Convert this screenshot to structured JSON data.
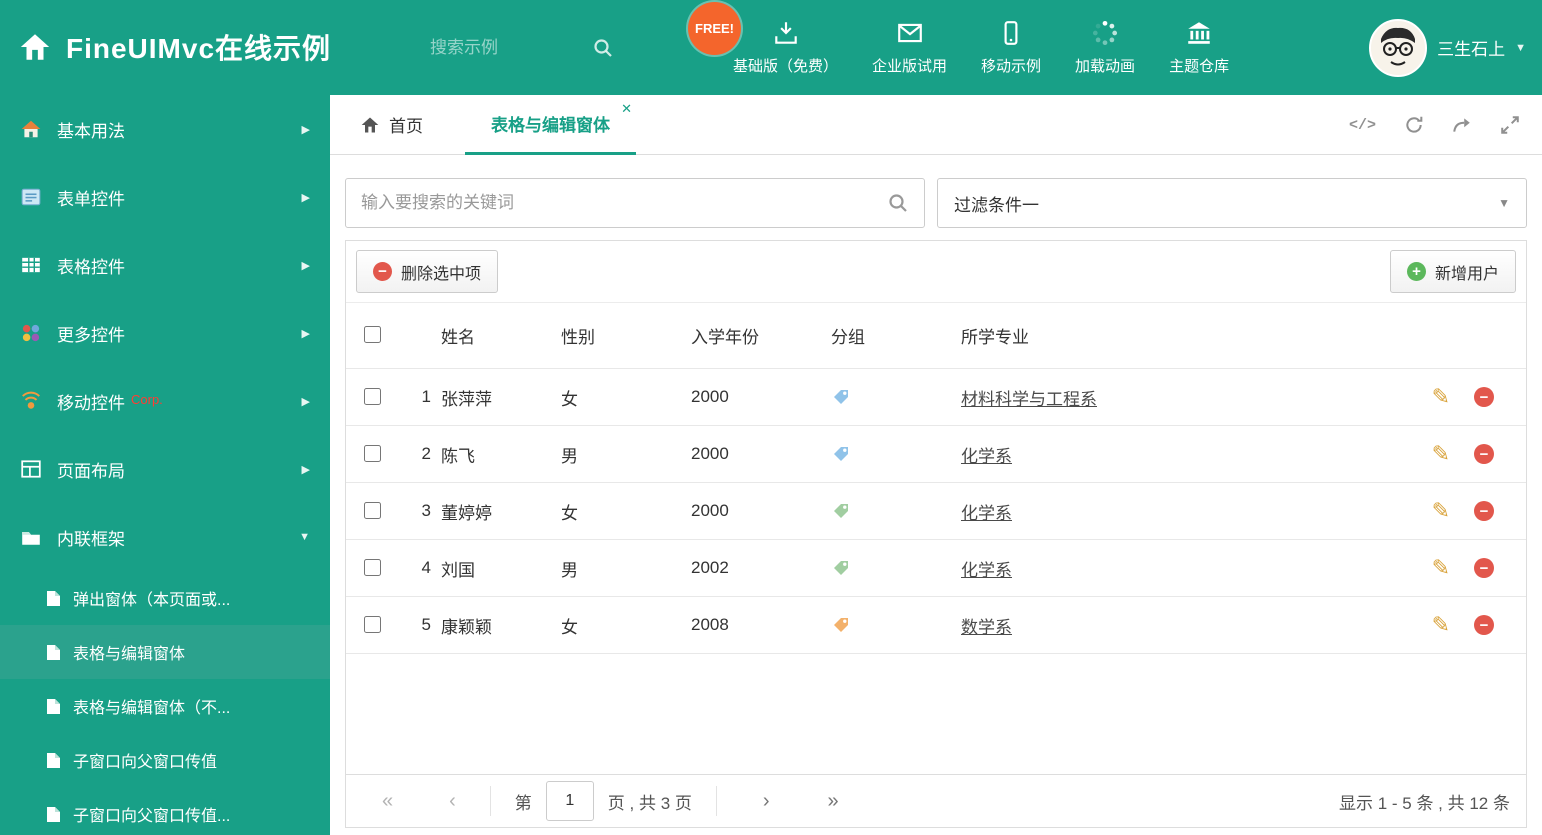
{
  "colors": {
    "theme": "#18A087",
    "sidebar_active": "#2BA28D",
    "free_badge": "#F4652C",
    "danger": "#E2574C",
    "success": "#5CB85C",
    "pencil": "#D9A33B"
  },
  "icons": {
    "chevron_right": "▶",
    "chevron_down": "▼",
    "caret_down": "▼",
    "close": "✕",
    "code": "</>",
    "pencil": "✎",
    "minus": "−",
    "plus": "+",
    "first": "«",
    "prev": "‹",
    "next": "›",
    "last": "»"
  },
  "header": {
    "title": "FineUIMvc在线示例",
    "search_placeholder": "搜索示例",
    "free_badge": "FREE!",
    "nav": [
      {
        "label": "基础版（免费）"
      },
      {
        "label": "企业版试用"
      },
      {
        "label": "移动示例"
      },
      {
        "label": "加载动画"
      },
      {
        "label": "主题仓库"
      }
    ],
    "user_name": "三生石上"
  },
  "sidebar": {
    "items": [
      {
        "label": "基本用法"
      },
      {
        "label": "表单控件"
      },
      {
        "label": "表格控件"
      },
      {
        "label": "更多控件"
      },
      {
        "label": "移动控件",
        "badge": "Corp."
      },
      {
        "label": "页面布局"
      },
      {
        "label": "内联框架"
      }
    ],
    "subitems": [
      {
        "label": "弹出窗体（本页面或..."
      },
      {
        "label": "表格与编辑窗体"
      },
      {
        "label": "表格与编辑窗体（不..."
      },
      {
        "label": "子窗口向父窗口传值"
      },
      {
        "label": "子窗口向父窗口传值..."
      }
    ]
  },
  "tabs": {
    "home_label": "首页",
    "active_label": "表格与编辑窗体"
  },
  "filter": {
    "search_placeholder": "输入要搜索的关键词",
    "dropdown_value": "过滤条件一"
  },
  "toolbar": {
    "delete_label": "删除选中项",
    "add_label": "新增用户"
  },
  "table": {
    "columns": [
      "姓名",
      "性别",
      "入学年份",
      "分组",
      "所学专业"
    ],
    "rows": [
      {
        "num": "1",
        "name": "张萍萍",
        "gender": "女",
        "year": "2000",
        "tag_color": "#7CB9E5",
        "major": "材料科学与工程系"
      },
      {
        "num": "2",
        "name": "陈飞",
        "gender": "男",
        "year": "2000",
        "tag_color": "#7CB9E5",
        "major": "化学系"
      },
      {
        "num": "3",
        "name": "董婷婷",
        "gender": "女",
        "year": "2000",
        "tag_color": "#90C590",
        "major": "化学系"
      },
      {
        "num": "4",
        "name": "刘国",
        "gender": "男",
        "year": "2002",
        "tag_color": "#90C590",
        "major": "化学系"
      },
      {
        "num": "5",
        "name": "康颖颖",
        "gender": "女",
        "year": "2008",
        "tag_color": "#F1A351",
        "major": "数学系"
      }
    ]
  },
  "pagination": {
    "page_prefix": "第",
    "page_value": "1",
    "page_suffix": "页 , 共 3 页",
    "summary": "显示 1 - 5 条 , 共 12 条"
  }
}
